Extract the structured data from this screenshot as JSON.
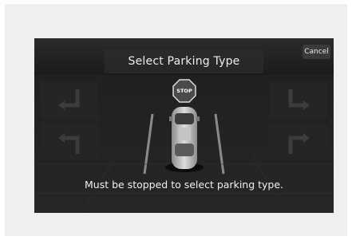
{
  "header": {
    "title": "Select Parking Type",
    "cancel_label": "Cancel"
  },
  "stop_sign": {
    "label": "STOP"
  },
  "message": "Must be stopped to select parking type.",
  "icons": [
    "stop-sign-icon",
    "vehicle-icon",
    "reverse-left-icon",
    "forward-left-icon",
    "reverse-right-icon",
    "forward-right-icon"
  ],
  "colors": {
    "background": "#1d1d1d",
    "text": "#ececec",
    "stop": "#4a4a4a"
  }
}
